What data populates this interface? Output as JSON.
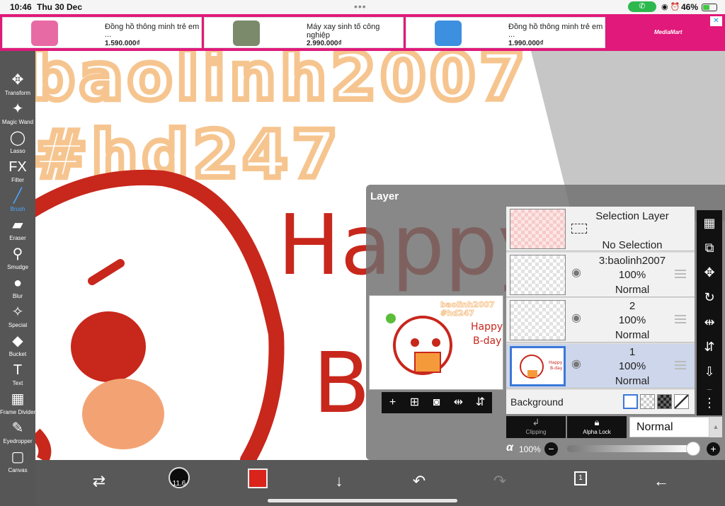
{
  "status_bar": {
    "time": "10:46",
    "date": "Thu 30 Dec",
    "battery_pct": "46%",
    "battery_level": 0.46,
    "call_icon": "phone-icon",
    "wifi_icon": "wifi-icon",
    "alarm_icon": "alarm-icon"
  },
  "ads": {
    "items": [
      {
        "title": "Đồng hồ thông minh trẻ em",
        "more": "...",
        "price": "1.590.000₫",
        "thumb_color": "#e86aa4"
      },
      {
        "title": "Máy xay sinh tố công nghiệp",
        "more": "...",
        "price": "2.990.000₫",
        "thumb_color": "#7a8a6a"
      },
      {
        "title": "Đồng hồ thông minh trẻ em",
        "more": "...",
        "price": "1.990.000₫",
        "thumb_color": "#3d8fe0"
      }
    ],
    "brand": "MediaMart",
    "close_label": "✕",
    "background": "#e0197a"
  },
  "tools": [
    {
      "label": "Transform",
      "icon": "move-icon",
      "glyph": "✥",
      "active": false
    },
    {
      "label": "Magic Wand",
      "icon": "magic-wand-icon",
      "glyph": "✦",
      "active": false
    },
    {
      "label": "Lasso",
      "icon": "lasso-icon",
      "glyph": "◯",
      "active": false
    },
    {
      "label": "Filter",
      "icon": "fx-icon",
      "glyph": "FX",
      "active": false
    },
    {
      "label": "Brush",
      "icon": "brush-icon",
      "glyph": "╱",
      "active": true
    },
    {
      "label": "Eraser",
      "icon": "eraser-icon",
      "glyph": "▰",
      "active": false
    },
    {
      "label": "Smudge",
      "icon": "smudge-icon",
      "glyph": "⚲",
      "active": false
    },
    {
      "label": "Blur",
      "icon": "blur-drop-icon",
      "glyph": "●",
      "active": false
    },
    {
      "label": "Special",
      "icon": "special-brush-icon",
      "glyph": "✧",
      "active": false
    },
    {
      "label": "Bucket",
      "icon": "bucket-icon",
      "glyph": "◆",
      "active": false
    },
    {
      "label": "Text",
      "icon": "text-icon",
      "glyph": "T",
      "active": false
    },
    {
      "label": "Frame Divider",
      "icon": "frame-divider-icon",
      "glyph": "▦",
      "active": false
    },
    {
      "label": "Eyedropper",
      "icon": "eyedropper-icon",
      "glyph": "✎",
      "active": false
    },
    {
      "label": "Canvas",
      "icon": "canvas-icon",
      "glyph": "▢",
      "active": false
    }
  ],
  "bottom_bar": {
    "brush_size": "11.6",
    "current_color": "#d9231b",
    "page_count": "1",
    "icons": [
      "quick-transform-icon",
      "brush-size-icon",
      "color-swatch",
      "download-arrow-icon",
      "undo-icon",
      "redo-icon",
      "pages-icon",
      "back-arrow-icon"
    ]
  },
  "canvas": {
    "watermark_line1": "baolinh2007",
    "watermark_line2": "#hd247",
    "greeting_line1": "Happy",
    "greeting_line2": "B",
    "watermark_color": "#f6c58f",
    "ink_color": "#c8271c",
    "blush_color": "#f3a373"
  },
  "layer_panel": {
    "title": "Layer",
    "preview": {
      "watermark": "baolinh2007",
      "watermark2": "#hd247",
      "greeting1": "Happy",
      "greeting2": "B-day"
    },
    "preview_tools": [
      "add-layer-icon",
      "duplicate-layer-icon",
      "camera-icon",
      "flip-horizontal-icon",
      "flip-vertical-icon"
    ],
    "layers": [
      {
        "name": "Selection Layer",
        "detail": "No Selection",
        "type": "selection"
      },
      {
        "name": "3:baolinh2007",
        "opacity": "100%",
        "blend": "Normal",
        "selected": false
      },
      {
        "name": "2",
        "opacity": "100%",
        "blend": "Normal",
        "selected": false
      },
      {
        "name": "1",
        "opacity": "100%",
        "blend": "Normal",
        "selected": true
      }
    ],
    "background_label": "Background",
    "right_icons": [
      "checkerboard-icon",
      "merge-icon",
      "move-icon",
      "rotate-icon",
      "flip-horizontal-icon",
      "flip-vertical-icon",
      "download-icon",
      "trash-icon",
      "more-icon"
    ],
    "clipping_label": "Clipping",
    "alpha_lock_label": "Alpha Lock",
    "blend_mode": "Normal",
    "alpha_symbol": "α",
    "alpha_value": "100%",
    "alpha_level": 1.0
  }
}
